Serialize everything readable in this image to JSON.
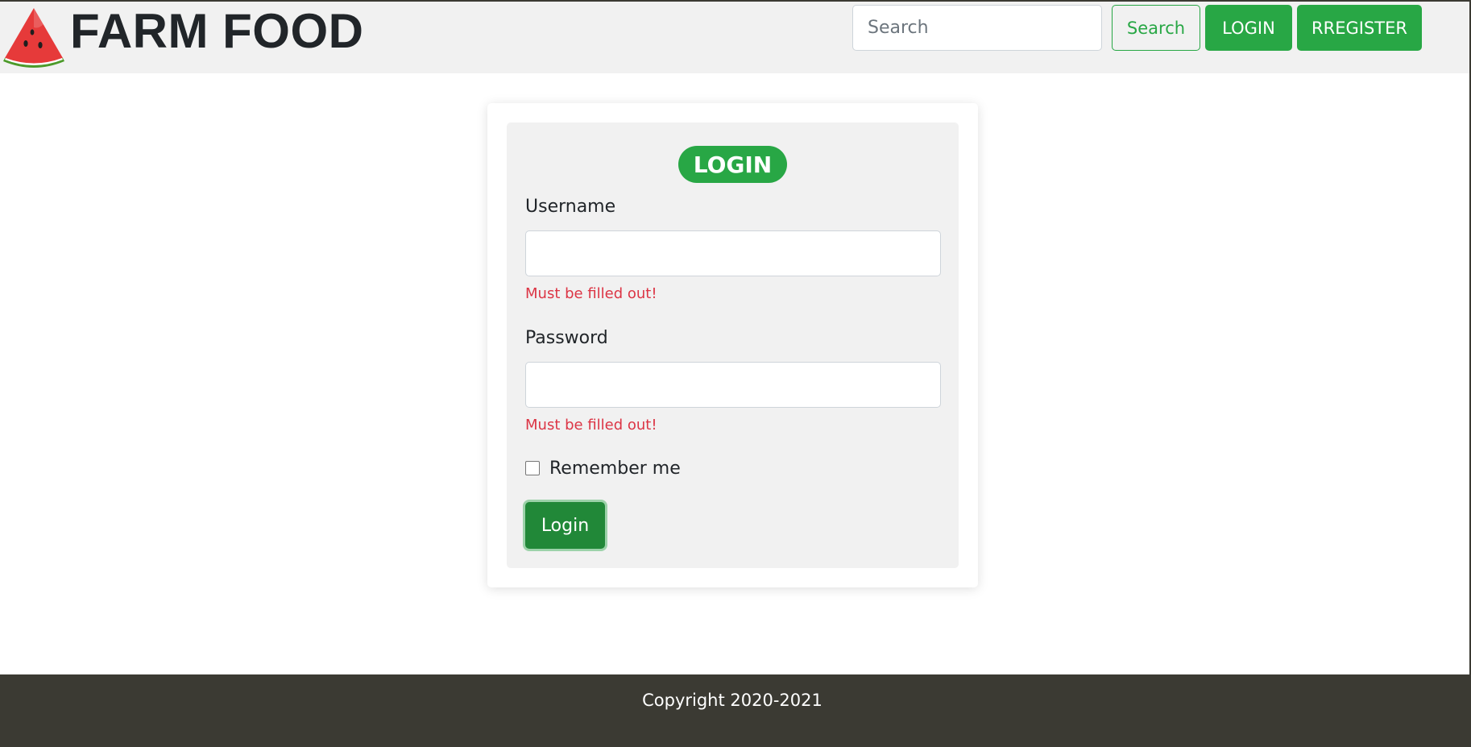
{
  "header": {
    "brand": "FARM FOOD",
    "logo_icon": "watermelon-slice-icon",
    "search_placeholder": "Search",
    "search_value": "",
    "search_button": "Search",
    "login_button": "LOGIN",
    "register_button": "RREGISTER"
  },
  "login_form": {
    "badge": "LOGIN",
    "username_label": "Username",
    "username_value": "",
    "username_error": "Must be filled out!",
    "password_label": "Password",
    "password_value": "",
    "password_error": "Must be filled out!",
    "remember_label": "Remember me",
    "remember_checked": false,
    "submit_button": "Login"
  },
  "footer": {
    "copyright": "Copyright 2020-2021"
  },
  "colors": {
    "accent_green": "#28a745",
    "pressed_green": "#218838",
    "error_red": "#dc3545",
    "header_bg": "#f1f1f1",
    "footer_bg": "#3b3a33"
  }
}
